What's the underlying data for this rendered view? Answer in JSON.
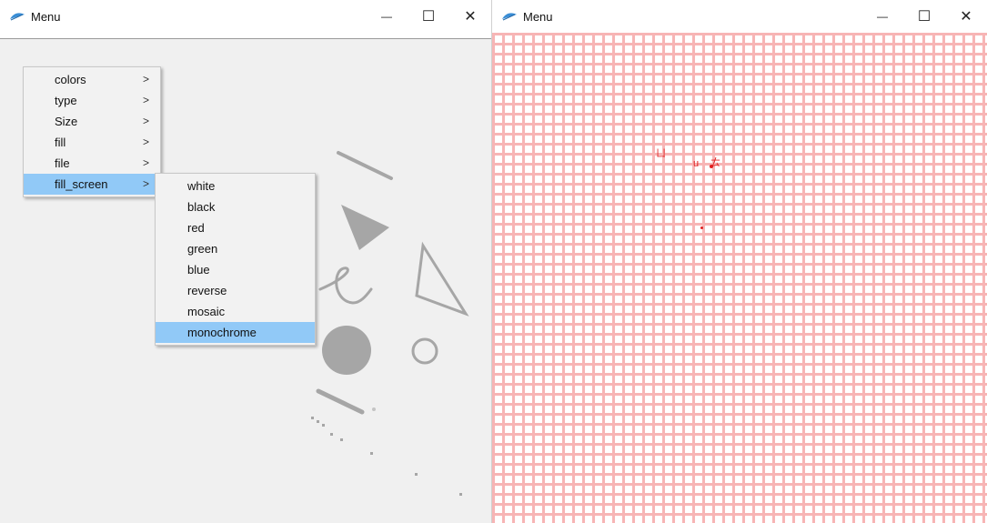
{
  "left_window": {
    "title": "Menu",
    "controls": {
      "minimize": "—",
      "maximize": "☐",
      "close": "✕"
    },
    "menu": {
      "items": [
        {
          "label": "colors",
          "arrow": ">"
        },
        {
          "label": "type",
          "arrow": ">"
        },
        {
          "label": "Size",
          "arrow": ">"
        },
        {
          "label": "fill",
          "arrow": ">"
        },
        {
          "label": "file",
          "arrow": ">"
        },
        {
          "label": "fill_screen",
          "arrow": ">"
        }
      ],
      "highlighted": "fill_screen"
    },
    "submenu": {
      "items": [
        "white",
        "black",
        "red",
        "green",
        "blue",
        "reverse",
        "mosaic",
        "monochrome"
      ],
      "highlighted": "monochrome"
    },
    "canvas_color": "#f0f0f0",
    "shape_color": "#a6a6a6",
    "menu_highlight_color": "#91c9f7"
  },
  "right_window": {
    "title": "Menu",
    "controls": {
      "minimize": "—",
      "maximize": "☐",
      "close": "✕"
    },
    "canvas": {
      "fill": "mosaic",
      "grid_color": "#f7b5b5",
      "mark_color": "#e02020",
      "marks": [
        "ㄩ",
        "u",
        "ㄊ"
      ]
    }
  }
}
